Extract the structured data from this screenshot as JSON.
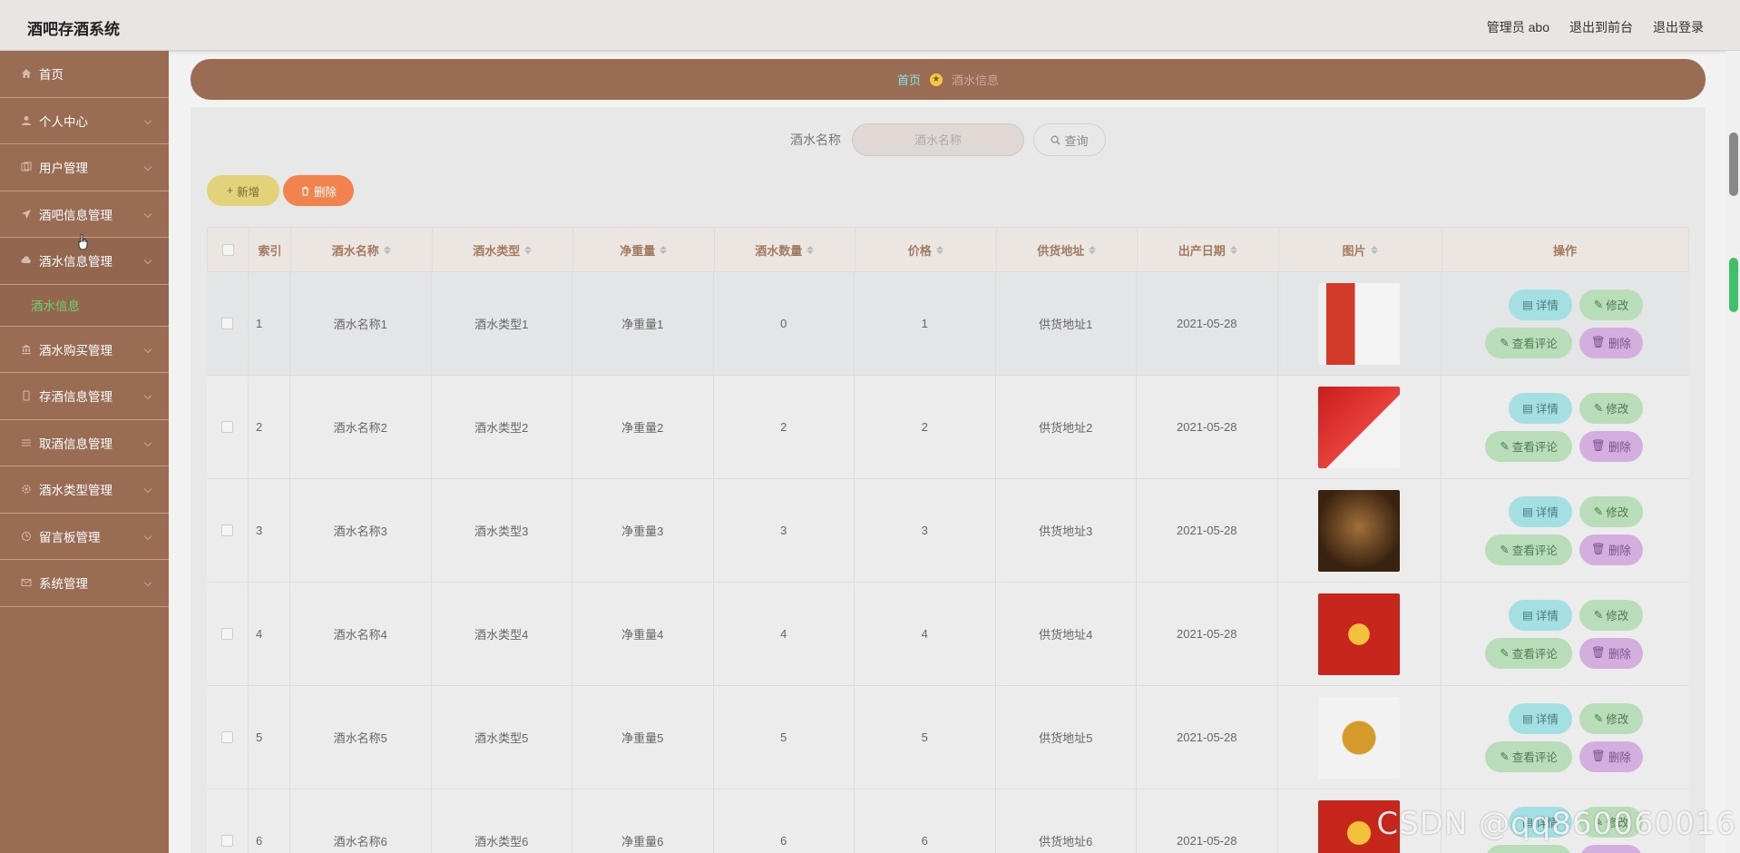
{
  "app": {
    "title": "酒吧存酒系统"
  },
  "header": {
    "admin_label": "管理员 abo",
    "back_front": "退出到前台",
    "logout": "退出登录"
  },
  "sidebar": {
    "items": [
      {
        "label": "首页",
        "icon": "home-icon"
      },
      {
        "label": "个人中心",
        "icon": "user-icon"
      },
      {
        "label": "用户管理",
        "icon": "users-icon"
      },
      {
        "label": "酒吧信息管理",
        "icon": "send-icon"
      },
      {
        "label": "酒水信息管理",
        "icon": "cloud-icon"
      },
      {
        "label": "酒水购买管理",
        "icon": "bank-icon"
      },
      {
        "label": "存酒信息管理",
        "icon": "phone-icon"
      },
      {
        "label": "取酒信息管理",
        "icon": "sliders-icon"
      },
      {
        "label": "酒水类型管理",
        "icon": "gear-icon"
      },
      {
        "label": "留言板管理",
        "icon": "clock-icon"
      },
      {
        "label": "系统管理",
        "icon": "mail-icon"
      }
    ],
    "sub_item": "酒水信息"
  },
  "breadcrumb": {
    "home": "首页",
    "current": "酒水信息"
  },
  "search": {
    "label": "酒水名称",
    "placeholder": "酒水名称",
    "button": "查询"
  },
  "actions": {
    "add": "新增",
    "delete": "删除"
  },
  "table": {
    "headers": {
      "index": "索引",
      "name": "酒水名称",
      "type": "酒水类型",
      "weight": "净重量",
      "qty": "酒水数量",
      "price": "价格",
      "addr": "供货地址",
      "date": "出产日期",
      "img": "图片",
      "ops": "操作"
    },
    "rows": [
      {
        "index": "1",
        "name": "酒水名称1",
        "type": "酒水类型1",
        "weight": "净重量1",
        "qty": "0",
        "price": "1",
        "addr": "供货地址1",
        "date": "2021-05-28"
      },
      {
        "index": "2",
        "name": "酒水名称2",
        "type": "酒水类型2",
        "weight": "净重量2",
        "qty": "2",
        "price": "2",
        "addr": "供货地址2",
        "date": "2021-05-28"
      },
      {
        "index": "3",
        "name": "酒水名称3",
        "type": "酒水类型3",
        "weight": "净重量3",
        "qty": "3",
        "price": "3",
        "addr": "供货地址3",
        "date": "2021-05-28"
      },
      {
        "index": "4",
        "name": "酒水名称4",
        "type": "酒水类型4",
        "weight": "净重量4",
        "qty": "4",
        "price": "4",
        "addr": "供货地址4",
        "date": "2021-05-28"
      },
      {
        "index": "5",
        "name": "酒水名称5",
        "type": "酒水类型5",
        "weight": "净重量5",
        "qty": "5",
        "price": "5",
        "addr": "供货地址5",
        "date": "2021-05-28"
      },
      {
        "index": "6",
        "name": "酒水名称6",
        "type": "酒水类型6",
        "weight": "净重量6",
        "qty": "6",
        "price": "6",
        "addr": "供货地址6",
        "date": "2021-05-28"
      }
    ],
    "op_labels": {
      "detail": "详情",
      "edit": "修改",
      "review": "查看评论",
      "delete": "删除"
    }
  },
  "watermark": "CSDN @qq860060016"
}
